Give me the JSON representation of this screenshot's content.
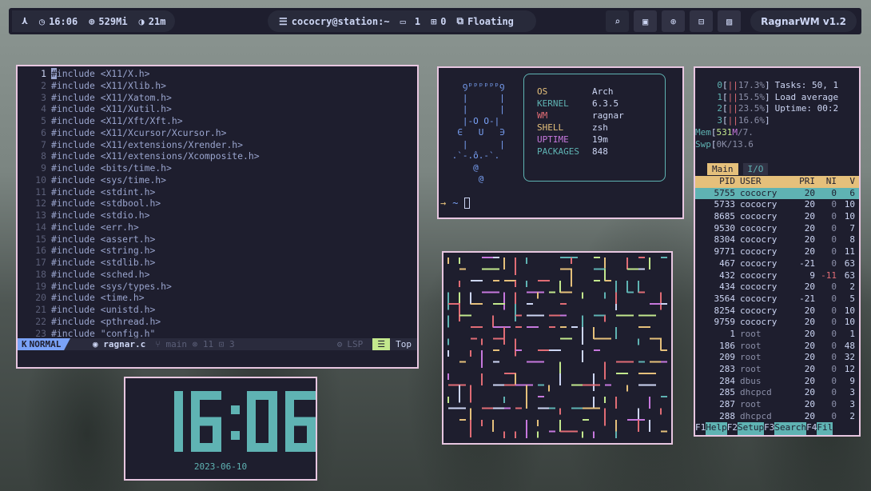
{
  "topbar": {
    "clock_time": "16:06",
    "memory": "529Mi",
    "uptime": "21m",
    "user_host": "cococry@station:~",
    "monitor_count": "1",
    "workspace": "0",
    "layout": "Floating",
    "wm_version": "RagnarWM v1.2"
  },
  "editor": {
    "lines": [
      {
        "n": "1",
        "text": "#include <X11/X.h>"
      },
      {
        "n": "2",
        "text": "#include <X11/Xlib.h>"
      },
      {
        "n": "3",
        "text": "#include <X11/Xatom.h>"
      },
      {
        "n": "4",
        "text": "#include <X11/Xutil.h>"
      },
      {
        "n": "5",
        "text": "#include <X11/Xft/Xft.h>"
      },
      {
        "n": "6",
        "text": "#include <X11/Xcursor/Xcursor.h>"
      },
      {
        "n": "7",
        "text": "#include <X11/extensions/Xrender.h>"
      },
      {
        "n": "8",
        "text": "#include <X11/extensions/Xcomposite.h>"
      },
      {
        "n": "9",
        "text": "#include <bits/time.h>"
      },
      {
        "n": "10",
        "text": "#include <sys/time.h>"
      },
      {
        "n": "11",
        "text": "#include <stdint.h>"
      },
      {
        "n": "12",
        "text": "#include <stdbool.h>"
      },
      {
        "n": "13",
        "text": "#include <stdio.h>"
      },
      {
        "n": "14",
        "text": "#include <err.h>"
      },
      {
        "n": "15",
        "text": "#include <assert.h>"
      },
      {
        "n": "16",
        "text": "#include <string.h>"
      },
      {
        "n": "17",
        "text": "#include <stdlib.h>"
      },
      {
        "n": "18",
        "text": "#include <sched.h>"
      },
      {
        "n": "19",
        "text": "#include <sys/types.h>"
      },
      {
        "n": "20",
        "text": "#include <time.h>"
      },
      {
        "n": "21",
        "text": "#include <unistd.h>"
      },
      {
        "n": "22",
        "text": "#include <pthread.h>"
      },
      {
        "n": "23",
        "text": "#include \"config.h\""
      }
    ],
    "status": {
      "mode": "NORMAL",
      "file": "ragnar.c",
      "branch": "main",
      "errors": "11",
      "warnings": "3",
      "lsp": "LSP",
      "position": "Top"
    }
  },
  "fetch": {
    "info": [
      {
        "key": "OS",
        "value": "Arch",
        "color": "#e5c07b"
      },
      {
        "key": "KERNEL",
        "value": "6.3.5",
        "color": "#5fb3b3"
      },
      {
        "key": "WM",
        "value": "ragnar",
        "color": "#e06c75"
      },
      {
        "key": "SHELL",
        "value": "zsh",
        "color": "#e5c07b"
      },
      {
        "key": "UPTIME",
        "value": "19m",
        "color": "#c678dd"
      },
      {
        "key": "PACKAGES",
        "value": "848",
        "color": "#5fb3b3"
      }
    ],
    "prompt": "~"
  },
  "htop": {
    "cpus": [
      {
        "id": "0",
        "pct": "17.3%",
        "side": "Tasks: 50, 1"
      },
      {
        "id": "1",
        "pct": "15.5%",
        "side": "Load average"
      },
      {
        "id": "2",
        "pct": "23.5%",
        "side": "Uptime: 00:2"
      },
      {
        "id": "3",
        "pct": "16.6%",
        "side": ""
      }
    ],
    "mem": {
      "label": "Mem",
      "used": "531",
      "unit": "M",
      "total": "/7."
    },
    "swp": {
      "label": "Swp",
      "used": "0K",
      "total": "/13.6"
    },
    "tabs": {
      "main": "Main",
      "io": "I/O"
    },
    "columns": {
      "pid": "PID",
      "user": "USER",
      "pri": "PRI",
      "ni": "NI",
      "v": "V"
    },
    "rows": [
      {
        "pid": "5755",
        "user": "cococry",
        "pri": "20",
        "ni": "0",
        "v": "6"
      },
      {
        "pid": "5733",
        "user": "cococry",
        "pri": "20",
        "ni": "0",
        "v": "10"
      },
      {
        "pid": "8685",
        "user": "cococry",
        "pri": "20",
        "ni": "0",
        "v": "10"
      },
      {
        "pid": "9530",
        "user": "cococry",
        "pri": "20",
        "ni": "0",
        "v": "7"
      },
      {
        "pid": "8304",
        "user": "cococry",
        "pri": "20",
        "ni": "0",
        "v": "8"
      },
      {
        "pid": "9771",
        "user": "cococry",
        "pri": "20",
        "ni": "0",
        "v": "11"
      },
      {
        "pid": "467",
        "user": "cococry",
        "pri": "-21",
        "ni": "0",
        "v": "63"
      },
      {
        "pid": "432",
        "user": "cococry",
        "pri": "9",
        "ni": "-11",
        "v": "63"
      },
      {
        "pid": "434",
        "user": "cococry",
        "pri": "20",
        "ni": "0",
        "v": "2"
      },
      {
        "pid": "3564",
        "user": "cococry",
        "pri": "-21",
        "ni": "0",
        "v": "5"
      },
      {
        "pid": "8254",
        "user": "cococry",
        "pri": "20",
        "ni": "0",
        "v": "10"
      },
      {
        "pid": "9759",
        "user": "cococry",
        "pri": "20",
        "ni": "0",
        "v": "10"
      },
      {
        "pid": "1",
        "user": "root",
        "pri": "20",
        "ni": "0",
        "v": "1"
      },
      {
        "pid": "186",
        "user": "root",
        "pri": "20",
        "ni": "0",
        "v": "48"
      },
      {
        "pid": "209",
        "user": "root",
        "pri": "20",
        "ni": "0",
        "v": "32"
      },
      {
        "pid": "283",
        "user": "root",
        "pri": "20",
        "ni": "0",
        "v": "12"
      },
      {
        "pid": "284",
        "user": "dbus",
        "pri": "20",
        "ni": "0",
        "v": "9"
      },
      {
        "pid": "285",
        "user": "dhcpcd",
        "pri": "20",
        "ni": "0",
        "v": "3"
      },
      {
        "pid": "287",
        "user": "root",
        "pri": "20",
        "ni": "0",
        "v": "3"
      },
      {
        "pid": "288",
        "user": "dhcpcd",
        "pri": "20",
        "ni": "0",
        "v": "2"
      }
    ],
    "fkeys": [
      {
        "key": "F1",
        "label": "Help"
      },
      {
        "key": "F2",
        "label": "Setup"
      },
      {
        "key": "F3",
        "label": "Search"
      },
      {
        "key": "F4",
        "label": "Fil"
      }
    ]
  },
  "clock_widget": {
    "time": "16:06",
    "date": "2023-06-10",
    "color": "#5fb3b3"
  },
  "colors": {
    "accent": "#7aa2f7",
    "border": "#e7c6e0",
    "teal": "#5fb3b3",
    "bg": "#1e1e2e"
  }
}
